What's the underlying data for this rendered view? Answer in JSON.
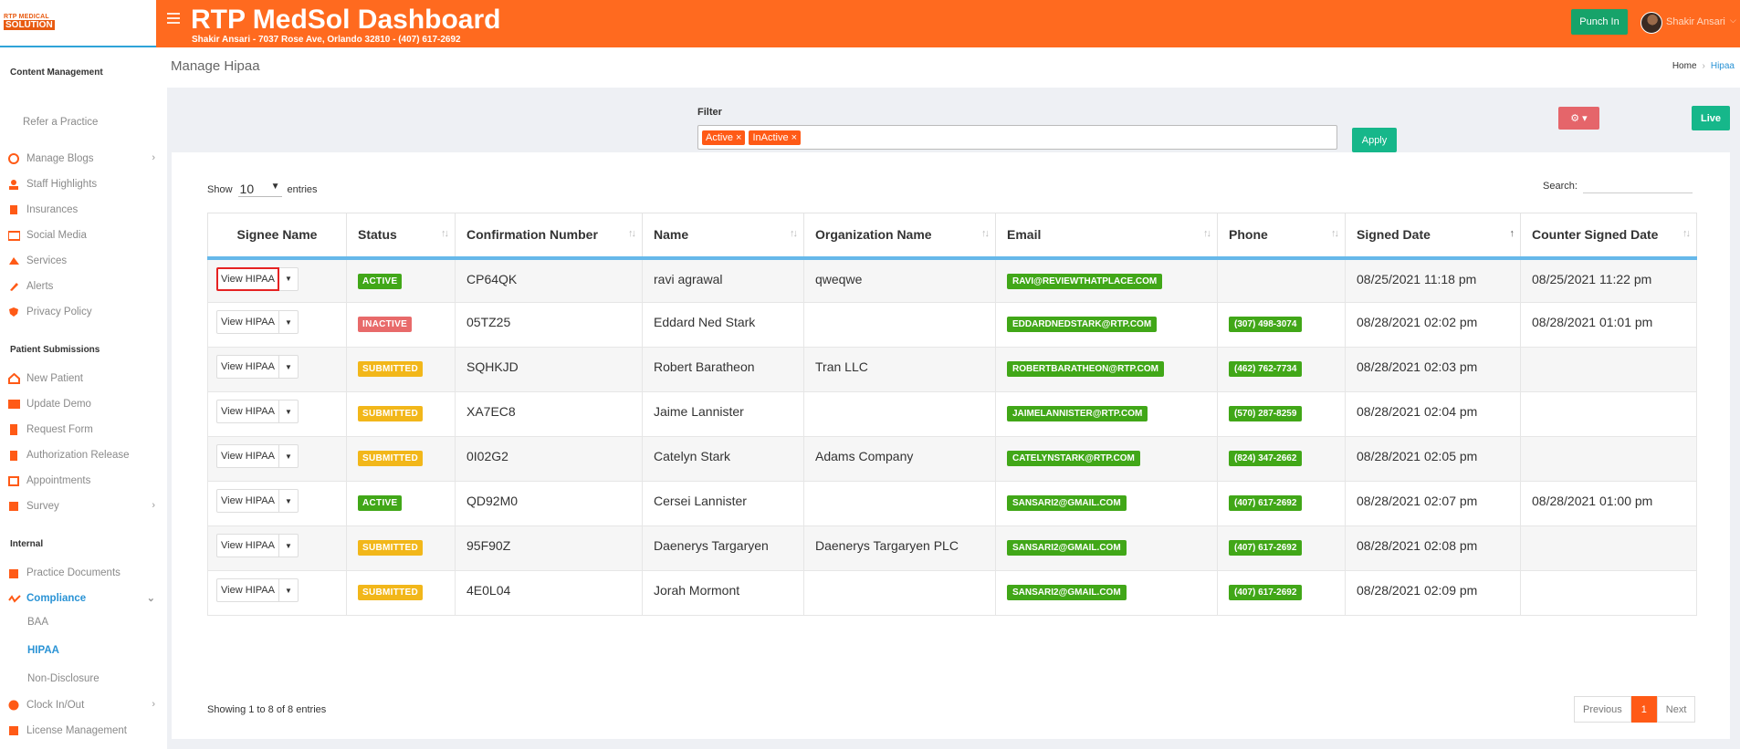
{
  "header": {
    "logo_line1": "RTP MEDICAL",
    "logo_line2": "SOLUTION",
    "title": "RTP MedSol Dashboard",
    "subtitle": "Shakir Ansari - 7037 Rose Ave, Orlando 32810 - (407) 617-2692",
    "punch_label": "Punch In",
    "user_name": "Shakir Ansari",
    "accent": "#ff6a1f"
  },
  "sidebar": {
    "sections": {
      "content": "Content Management",
      "patient": "Patient Submissions",
      "internal": "Internal"
    },
    "refer": "Refer a Practice",
    "content_items": [
      "Manage Blogs",
      "Staff Highlights",
      "Insurances",
      "Social Media",
      "Services",
      "Alerts",
      "Privacy Policy"
    ],
    "patient_items": [
      "New Patient",
      "Update Demo",
      "Request Form",
      "Authorization Release",
      "Appointments",
      "Survey"
    ],
    "internal_items": [
      "Practice Documents",
      "Compliance",
      "Clock In/Out",
      "License Management"
    ],
    "compliance_sub": [
      "BAA",
      "HIPAA",
      "Non-Disclosure"
    ]
  },
  "page": {
    "title": "Manage Hipaa",
    "breadcrumb_home": "Home",
    "breadcrumb_current": "Hipaa"
  },
  "filter": {
    "label": "Filter",
    "tags": [
      "Active ×",
      "InActive ×"
    ],
    "apply_label": "Apply",
    "gear_label": "⚙ ▾",
    "live_label": "Live"
  },
  "table_controls": {
    "show_label": "Show",
    "show_value": "10",
    "entries_label": "entries",
    "search_label": "Search:",
    "showing_text": "Showing 1 to 8 of 8 entries",
    "prev_label": "Previous",
    "page_label": "1",
    "next_label": "Next"
  },
  "table": {
    "columns": [
      "Signee Name",
      "Status",
      "Confirmation Number",
      "Name",
      "Organization Name",
      "Email",
      "Phone",
      "Signed Date",
      "Counter Signed Date"
    ],
    "view_label": "View HIPAA",
    "rows": [
      {
        "status": "ACTIVE",
        "status_class": "active",
        "conf": "CP64QK",
        "name": "ravi agrawal",
        "org": "qweqwe",
        "email": "RAVI@REVIEWTHATPLACE.COM",
        "phone": "",
        "signed": "08/25/2021 11:18 pm",
        "counter": "08/25/2021 11:22 pm"
      },
      {
        "status": "INACTIVE",
        "status_class": "inactive",
        "conf": "05TZ25",
        "name": "Eddard Ned Stark",
        "org": "",
        "email": "EDDARDNEDSTARK@RTP.COM",
        "phone": "(307) 498-3074",
        "signed": "08/28/2021 02:02 pm",
        "counter": "08/28/2021 01:01 pm"
      },
      {
        "status": "SUBMITTED",
        "status_class": "submitted",
        "conf": "SQHKJD",
        "name": "Robert Baratheon",
        "org": "Tran LLC",
        "email": "ROBERTBARATHEON@RTP.COM",
        "phone": "(462) 762-7734",
        "signed": "08/28/2021 02:03 pm",
        "counter": ""
      },
      {
        "status": "SUBMITTED",
        "status_class": "submitted",
        "conf": "XA7EC8",
        "name": "Jaime Lannister",
        "org": "",
        "email": "JAIMELANNISTER@RTP.COM",
        "phone": "(570) 287-8259",
        "signed": "08/28/2021 02:04 pm",
        "counter": ""
      },
      {
        "status": "SUBMITTED",
        "status_class": "submitted",
        "conf": "0I02G2",
        "name": "Catelyn Stark",
        "org": "Adams Company",
        "email": "CATELYNSTARK@RTP.COM",
        "phone": "(824) 347-2662",
        "signed": "08/28/2021 02:05 pm",
        "counter": ""
      },
      {
        "status": "ACTIVE",
        "status_class": "active",
        "conf": "QD92M0",
        "name": "Cersei Lannister",
        "org": "",
        "email": "SANSARI2@GMAIL.COM",
        "phone": "(407) 617-2692",
        "signed": "08/28/2021 02:07 pm",
        "counter": "08/28/2021 01:00 pm"
      },
      {
        "status": "SUBMITTED",
        "status_class": "submitted",
        "conf": "95F90Z",
        "name": "Daenerys Targaryen",
        "org": "Daenerys Targaryen PLC",
        "email": "SANSARI2@GMAIL.COM",
        "phone": "(407) 617-2692",
        "signed": "08/28/2021 02:08 pm",
        "counter": ""
      },
      {
        "status": "SUBMITTED",
        "status_class": "submitted",
        "conf": "4E0L04",
        "name": "Jorah Mormont",
        "org": "",
        "email": "SANSARI2@GMAIL.COM",
        "phone": "(407) 617-2692",
        "signed": "08/28/2021 02:09 pm",
        "counter": ""
      }
    ]
  }
}
